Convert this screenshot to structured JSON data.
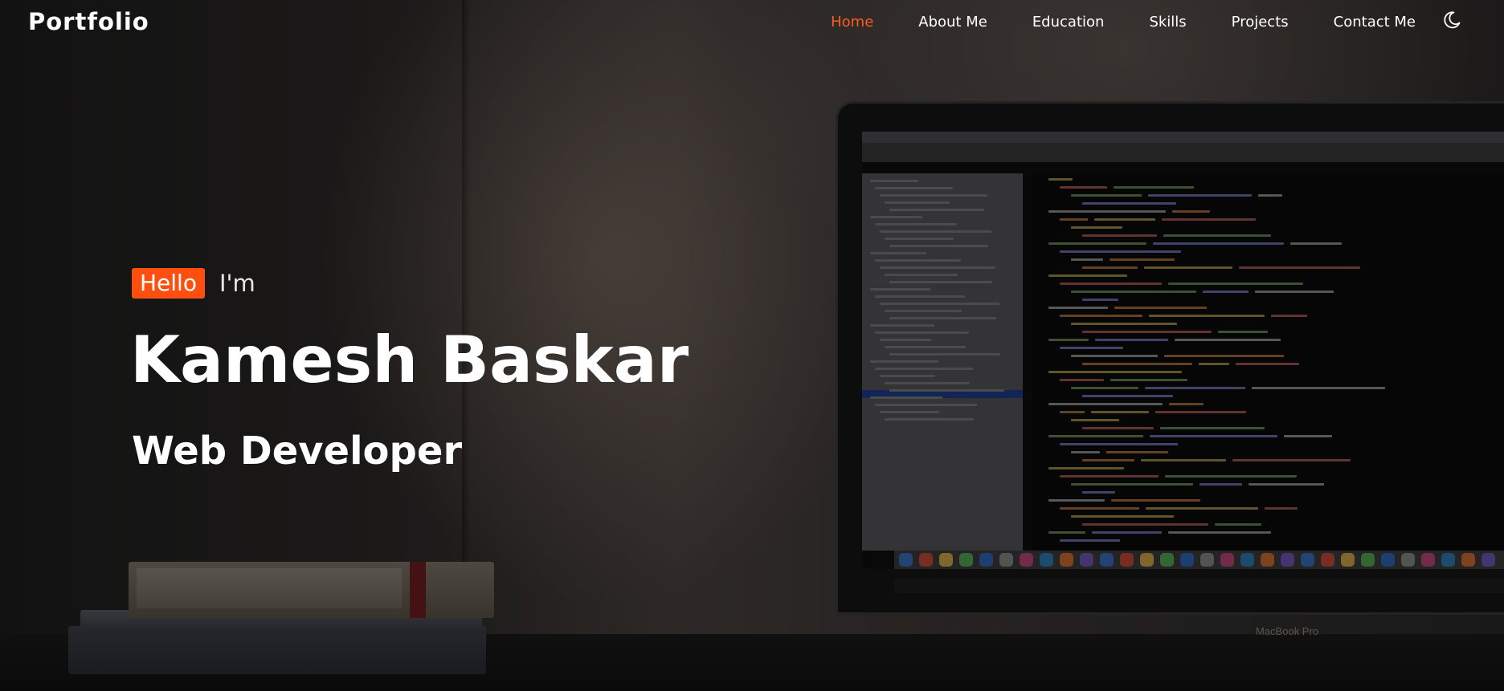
{
  "brand": {
    "logo": "Portfolio"
  },
  "nav": {
    "items": [
      {
        "label": "Home",
        "active": true
      },
      {
        "label": "About Me",
        "active": false
      },
      {
        "label": "Education",
        "active": false
      },
      {
        "label": "Skills",
        "active": false
      },
      {
        "label": "Projects",
        "active": false
      },
      {
        "label": "Contact Me",
        "active": false
      }
    ],
    "theme_toggle_icon": "moon-icon",
    "active_color": "#ff5a1f"
  },
  "hero": {
    "greeting_badge": "Hello",
    "greeting_suffix": "I'm",
    "name": "Kamesh Baskar",
    "role": "Web Developer",
    "accent_color": "#ff4f0f",
    "laptop_brand": "MacBook Pro"
  }
}
